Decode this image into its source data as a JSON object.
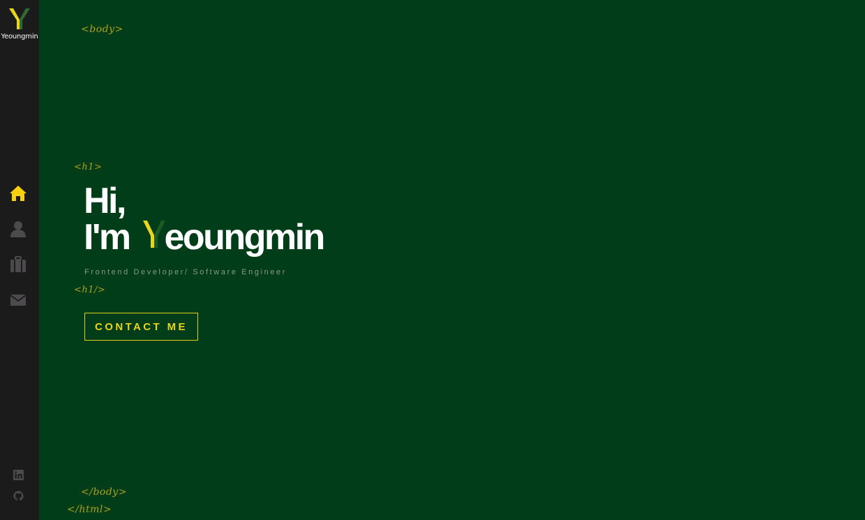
{
  "brand": {
    "logo_letter": "Y",
    "name": "Yeoungmin"
  },
  "sidebar": {
    "items": [
      {
        "name": "home",
        "icon": "home-icon",
        "active": true
      },
      {
        "name": "about",
        "icon": "user-icon",
        "active": false
      },
      {
        "name": "portfolio",
        "icon": "briefcase-icon",
        "active": false
      },
      {
        "name": "contact",
        "icon": "envelope-icon",
        "active": false
      }
    ],
    "social": [
      {
        "name": "linkedin",
        "icon": "linkedin-icon"
      },
      {
        "name": "github",
        "icon": "github-icon"
      }
    ]
  },
  "tags": {
    "body_open": "<body>",
    "h1_open": "<h1>",
    "h1_close": "<h1/>",
    "body_close": "</body>",
    "html_close": "</html>"
  },
  "hero": {
    "line1": "Hi,",
    "line2_prefix": "I'm ",
    "line2_suffix": "eoungmin",
    "subtitle": "Frontend Developer/ Software Engineer"
  },
  "cta": {
    "label": "CONTACT ME"
  },
  "colors": {
    "background": "#013d19",
    "sidebar": "#1c1b1c",
    "accent": "#e8d51d",
    "tag": "#aca11e",
    "icon_inactive": "#4c4a4c",
    "dark_green_y": "#1e5a28"
  }
}
